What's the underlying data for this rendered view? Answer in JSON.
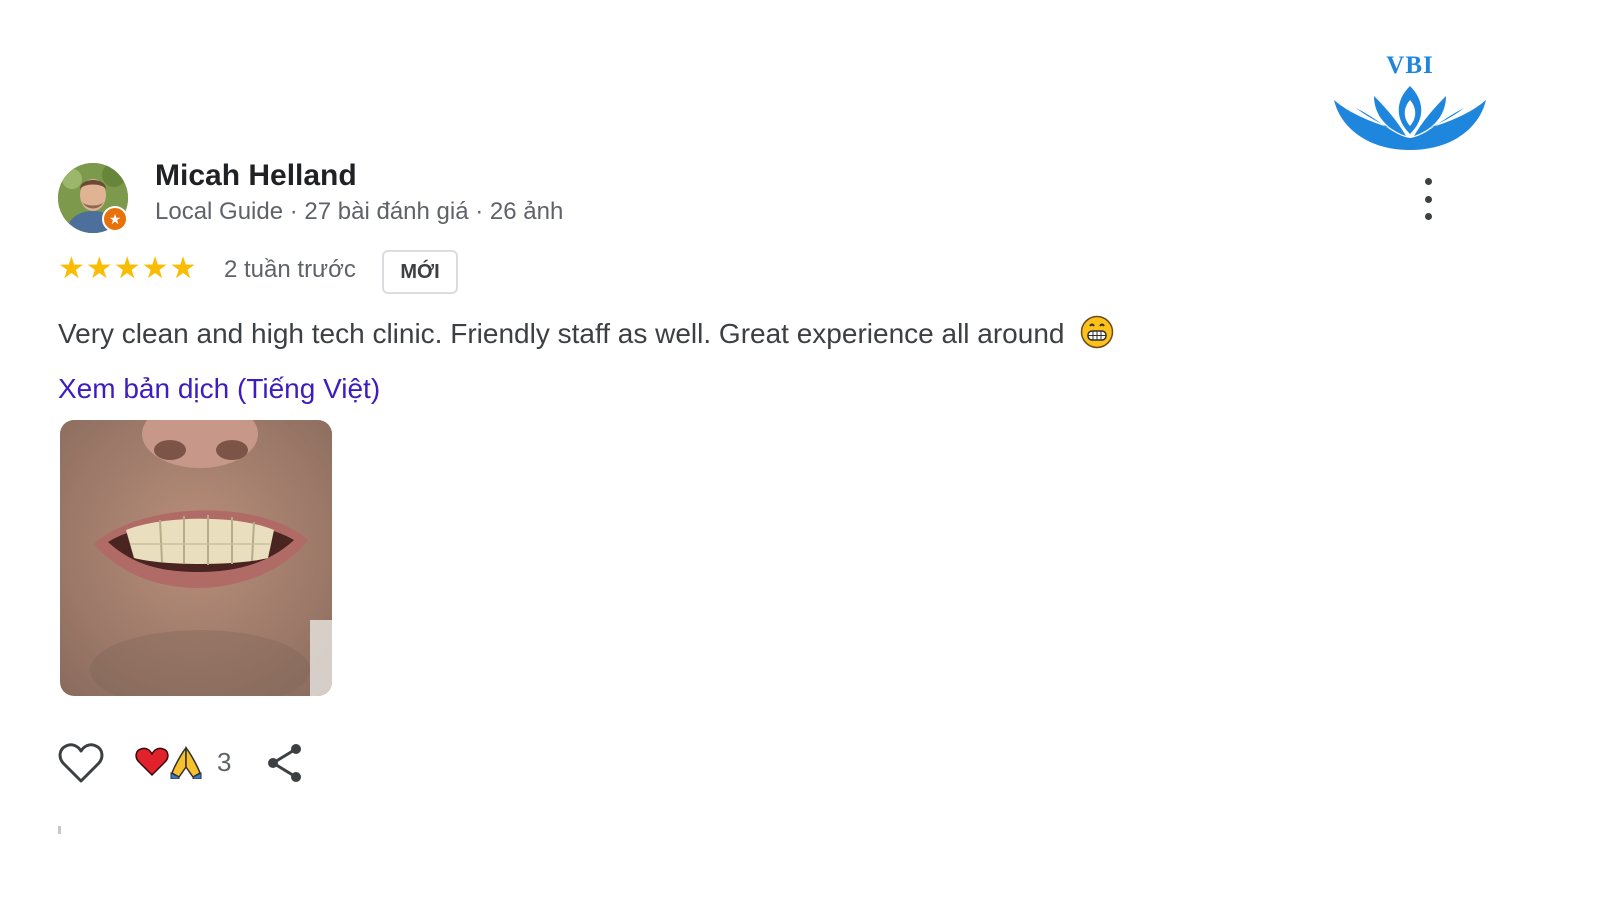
{
  "brand": {
    "logo_text": "VBI",
    "accent_color": "#1f86dd"
  },
  "review": {
    "author": {
      "name": "Micah Helland",
      "meta": "Local Guide · 27 bài đánh giá · 26 ảnh",
      "avatar_icon": "user-photo",
      "badge_icon": "local-guide-star-icon"
    },
    "rating": {
      "stars_text": "★★★★★",
      "value": 5,
      "max": 5,
      "color": "#fbbc04"
    },
    "time": "2 tuần trước",
    "new_badge": "MỚI",
    "text": "Very clean and high tech clinic. Friendly staff as well. Great experience all around",
    "text_emoji": "grinning-face-emoji",
    "translate_link": "Xem bản dịch (Tiếng Việt)",
    "photo_icon": "review-photo-smile",
    "actions": {
      "like_icon": "heart-outline-icon",
      "reactions_icons": [
        "red-heart-emoji",
        "folded-hands-emoji"
      ],
      "reaction_count": "3",
      "share_icon": "share-icon",
      "more_icon": "more-vert-icon"
    }
  }
}
